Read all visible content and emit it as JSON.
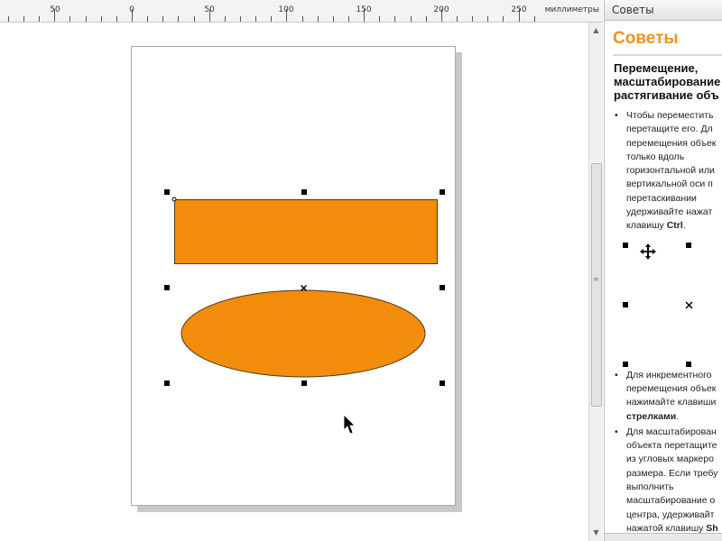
{
  "ruler": {
    "labels": [
      "50",
      "0",
      "50",
      "100",
      "150",
      "200",
      "250"
    ],
    "unit": "миллиметры"
  },
  "colors": {
    "shape_fill": "#f28c0a",
    "shape_stroke": "#4a3a1a",
    "accent": "#f0931e"
  },
  "canvas": {
    "shapes": [
      {
        "type": "rectangle",
        "selected": true
      },
      {
        "type": "ellipse",
        "selected": true
      }
    ],
    "selection_center_icon": "x-mark-icon",
    "cursor_icon": "arrow-cursor-icon"
  },
  "docker": {
    "title": "Советы",
    "heading": "Советы",
    "subheading": [
      "Перемещение,",
      "масштабирование",
      "растягивание объ"
    ],
    "tip1": {
      "lines": [
        "Чтобы переместить",
        "перетащите его. Дл",
        "перемещения объек",
        "только вдоль",
        "горизонтальной или",
        "вертикальной оси п",
        "перетаскивании",
        "удерживайте нажат"
      ],
      "last_prefix": "клавишу ",
      "key": "Ctrl",
      "last_suffix": "."
    },
    "illustration": {
      "move_icon": "move-cursor-icon",
      "center_icon": "x-mark-icon"
    },
    "tip2": {
      "lines": [
        "Для инкрементного",
        "перемещения объек",
        "нажимайте клавиши"
      ],
      "key": "стрелками",
      "key_suffix": "."
    },
    "tip3": {
      "lines": [
        "Для масштабирован",
        "объекта перетащите",
        "из угловых маркеро",
        "размера. Если требу",
        "выполнить",
        "масштабирование о",
        "центра, удерживайт"
      ],
      "last_prefix": "нажатой клавишу ",
      "key": "Sh"
    }
  }
}
